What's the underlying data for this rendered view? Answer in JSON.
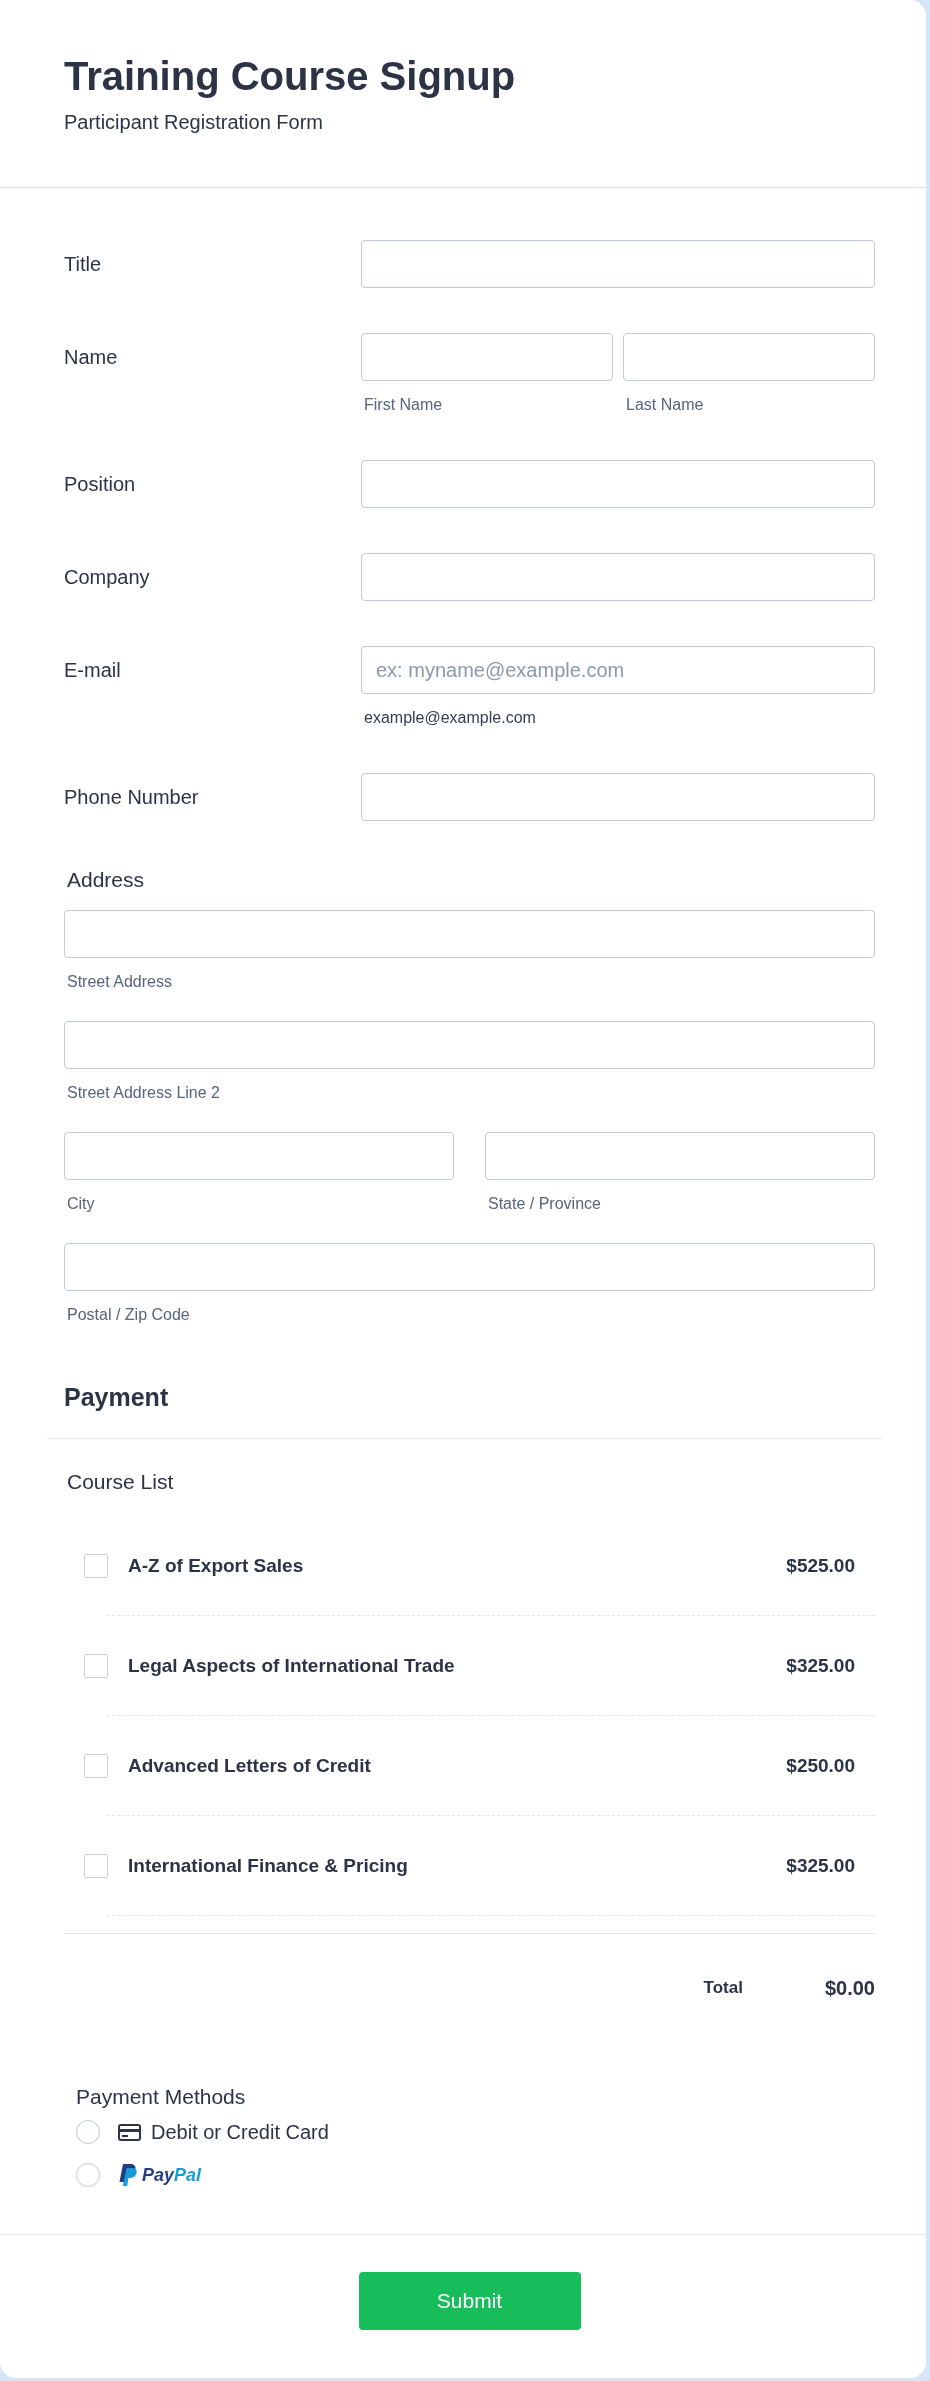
{
  "header": {
    "title": "Training Course Signup",
    "subtitle": "Participant Registration Form"
  },
  "fields": [
    {
      "kind": "text",
      "label": "Title"
    },
    {
      "kind": "name",
      "label": "Name",
      "inputs": [
        {
          "sublabel": "First Name"
        },
        {
          "sublabel": "Last Name"
        }
      ]
    },
    {
      "kind": "text",
      "label": "Position"
    },
    {
      "kind": "text",
      "label": "Company"
    },
    {
      "kind": "text",
      "label": "E-mail",
      "placeholder": "ex: myname@example.com",
      "sublabel": "example@example.com"
    },
    {
      "kind": "text",
      "label": "Phone Number"
    }
  ],
  "address": {
    "label": "Address",
    "rows": [
      {
        "inputs": [
          {
            "sublabel": "Street Address"
          }
        ]
      },
      {
        "inputs": [
          {
            "sublabel": "Street Address Line 2"
          }
        ]
      },
      {
        "inputs": [
          {
            "sublabel": "City"
          },
          {
            "sublabel": "State / Province"
          }
        ]
      },
      {
        "inputs": [
          {
            "sublabel": "Postal / Zip Code"
          }
        ]
      }
    ]
  },
  "payment": {
    "heading": "Payment",
    "list_label": "Course List",
    "courses": [
      {
        "name": "A-Z of Export Sales",
        "price": "$525.00",
        "checked": false
      },
      {
        "name": "Legal Aspects of International Trade",
        "price": "$325.00",
        "checked": false
      },
      {
        "name": "Advanced Letters of Credit",
        "price": "$250.00",
        "checked": false
      },
      {
        "name": "International Finance & Pricing",
        "price": "$325.00",
        "checked": false
      }
    ],
    "total_label": "Total",
    "total": "$0.00",
    "methods_label": "Payment Methods",
    "methods": [
      {
        "kind": "card",
        "label": "Debit or Credit Card",
        "selected": false
      },
      {
        "kind": "paypal",
        "label": "PayPal",
        "selected": false
      }
    ]
  },
  "submit": "Submit"
}
